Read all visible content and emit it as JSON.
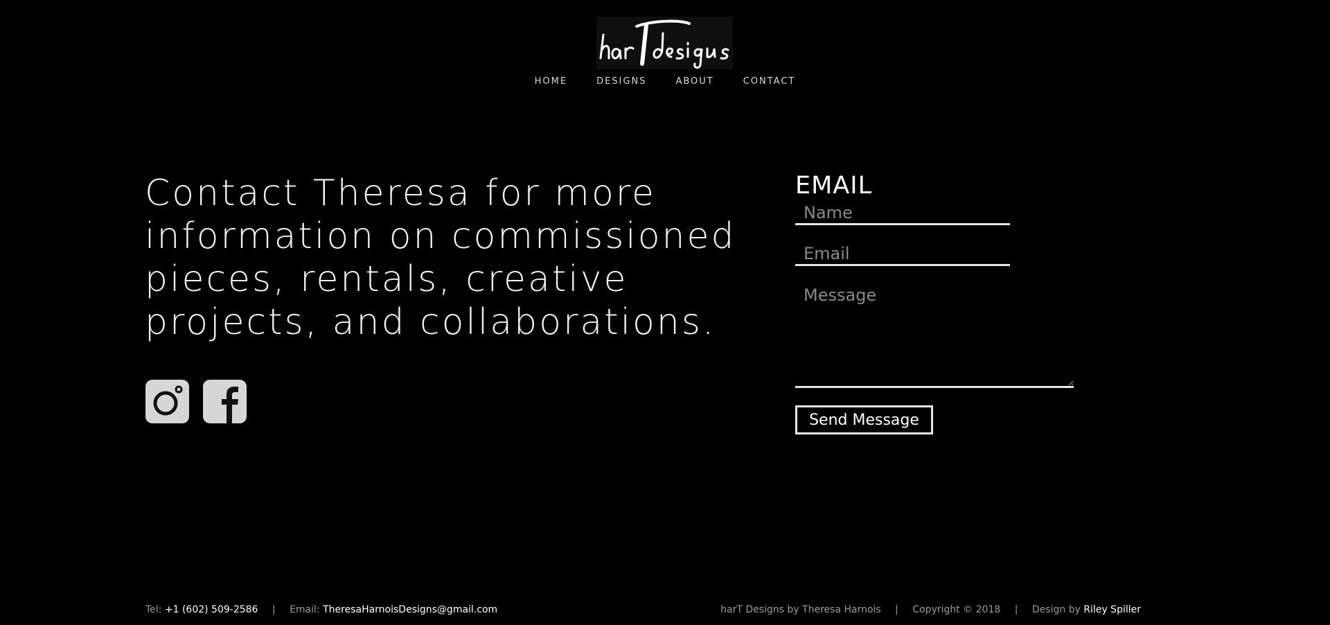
{
  "logo": {
    "text": "harT Designs"
  },
  "nav": {
    "items": [
      {
        "label": "HOME"
      },
      {
        "label": "DESIGNS"
      },
      {
        "label": "ABOUT"
      },
      {
        "label": "CONTACT"
      }
    ]
  },
  "main": {
    "headline": "Contact Theresa for more information on commissioned pieces, rentals, creative projects, and collaborations.",
    "social": [
      {
        "icon": "instagram-icon"
      },
      {
        "icon": "facebook-icon"
      }
    ]
  },
  "form": {
    "title": "EMAIL",
    "name_placeholder": "Name",
    "email_placeholder": "Email",
    "message_placeholder": "Message",
    "send_label": "Send Message"
  },
  "footer": {
    "tel_label": "Tel:",
    "tel_value": "+1 (602) 509-2586",
    "separator": "|",
    "email_label": "Email:",
    "email_value": "TheresaHarnoisDesigns@gmail.com",
    "credit": "harT Designs by Theresa Harnois",
    "copyright": "Copyright © 2018",
    "design_label": "Design by",
    "designer": "Riley Spiller"
  },
  "colors": {
    "background": "#000000",
    "text": "#ffffff",
    "muted": "#9a9a9a",
    "icon_bg": "#d6d6d6"
  }
}
